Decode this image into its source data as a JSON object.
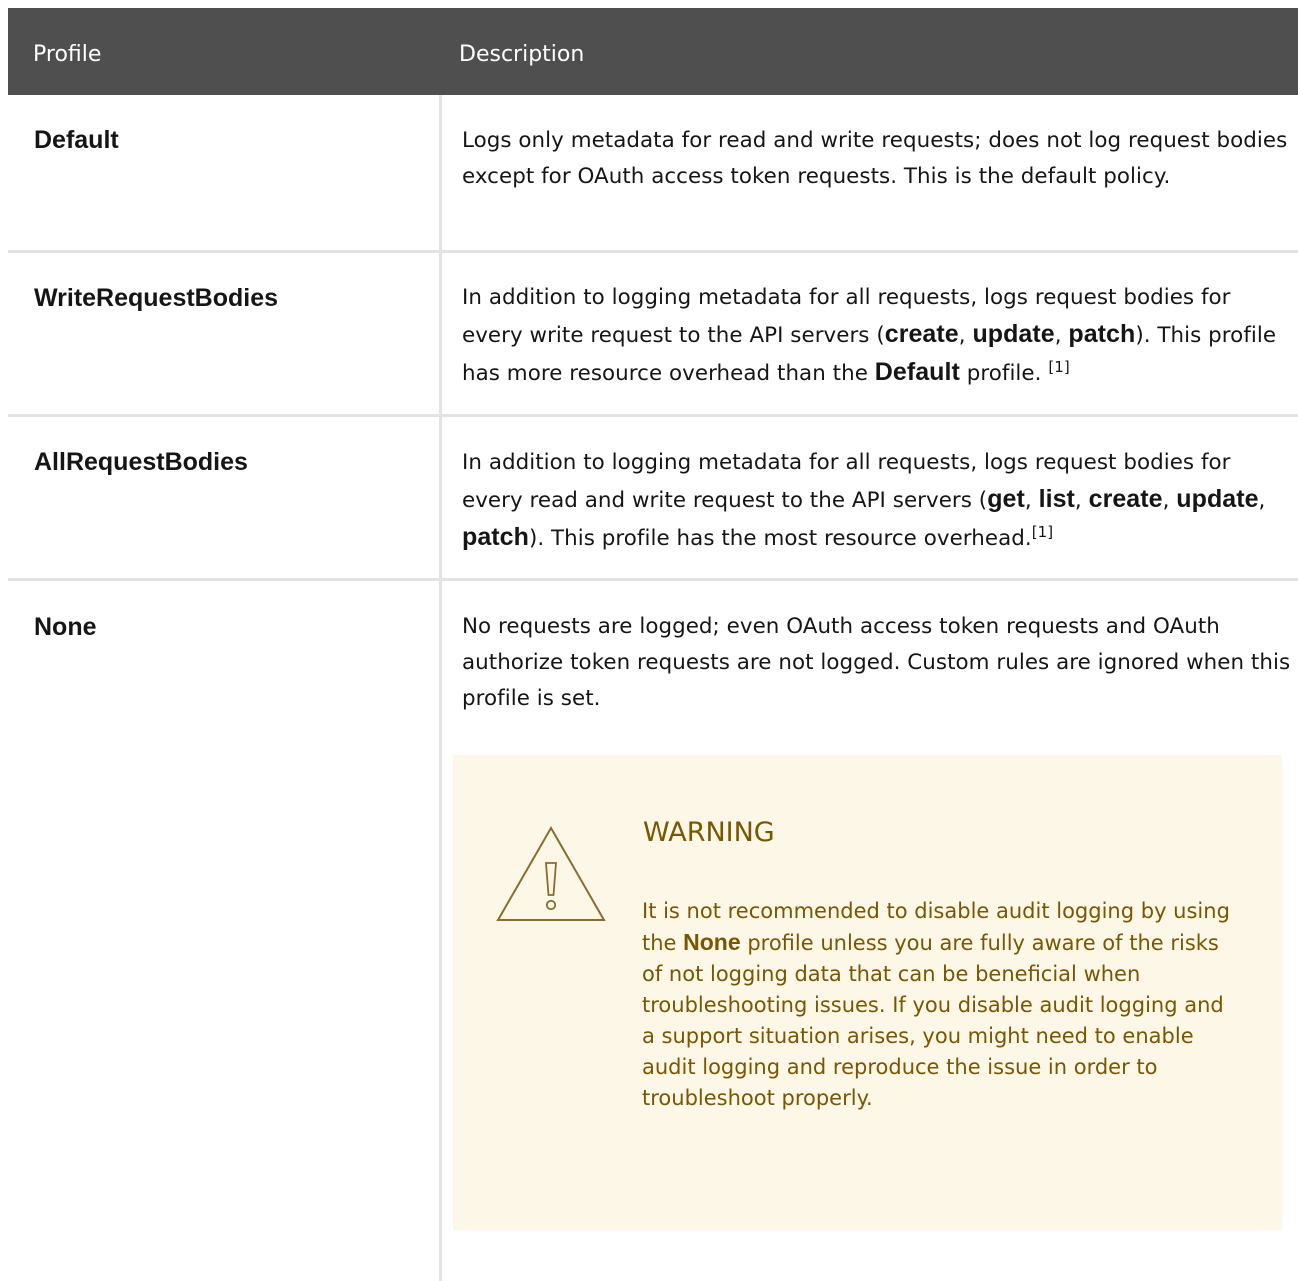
{
  "header": {
    "profile": "Profile",
    "description": "Description"
  },
  "rows": [
    {
      "name": "Default",
      "desc": "Logs only metadata for read and write requests; does not log request bodies except for OAuth access token requests. This is the default policy."
    },
    {
      "name": "WriteRequestBodies",
      "desc": {
        "t1": "In addition to logging metadata for all requests, logs request bodies for every write request to the API servers (",
        "k1": "create",
        "s1": ", ",
        "k2": "update",
        "s2": ", ",
        "k3": "patch",
        "t2": "). This profile has more resource overhead than the ",
        "k4": "Default",
        "t3": " profile. ",
        "note": "[1]"
      }
    },
    {
      "name": "AllRequestBodies",
      "desc": {
        "t1": "In addition to logging metadata for all requests, logs request bodies for every read and write request to the API servers (",
        "k1": "get",
        "s1": ", ",
        "k2": "list",
        "s2": ", ",
        "k3": "create",
        "s3": ", ",
        "k4": "update",
        "s4": ", ",
        "k5": "patch",
        "t2": "). This profile has the most resource overhead.",
        "note": "[1]"
      }
    },
    {
      "name": "None",
      "desc": "No requests are logged; even OAuth access token requests and OAuth authorize token requests are not logged. Custom rules are ignored when this profile is set."
    }
  ],
  "warning": {
    "title": "WARNING",
    "t1": "It is not recommended to disable audit logging by using the ",
    "k1": "None",
    "t2": " profile unless you are fully aware of the risks of not logging data that can be beneficial when troubleshooting issues. If you disable audit logging and a support situation arises, you might need to enable audit logging and reproduce the issue in order to troubleshoot properly."
  },
  "colors": {
    "header_bg": "#4f4f4f",
    "warning_bg": "#fdf7e7",
    "warning_text": "#795600",
    "rule": "#e3e3e3"
  },
  "icons": {
    "warning": "warning-triangle-icon"
  }
}
